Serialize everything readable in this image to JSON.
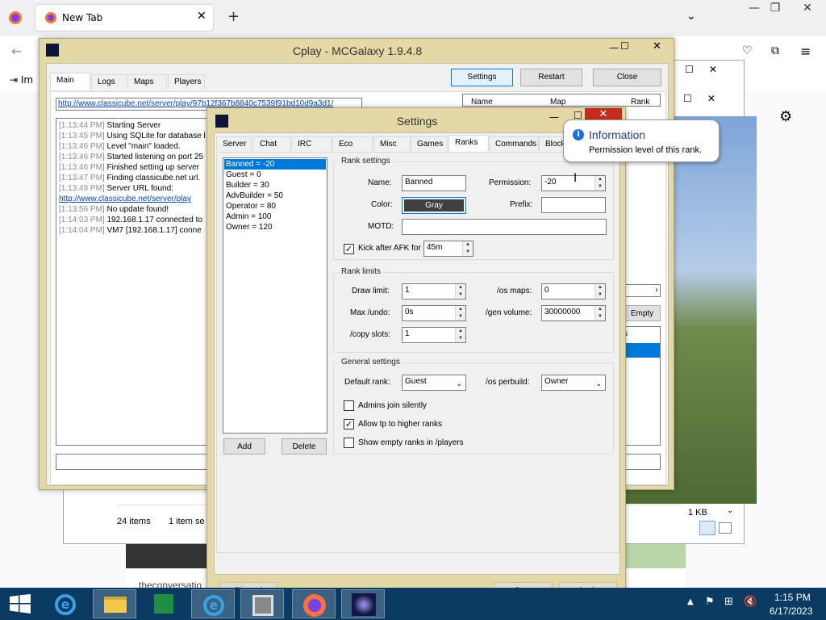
{
  "browser": {
    "tab_title": "New Tab",
    "new_tab_symbol": "+",
    "bookmark_import": "Im",
    "icons": [
      "firefox-icon",
      "close-icon",
      "back-icon",
      "pocket-icon",
      "extensions-icon",
      "menu-icon",
      "settings-icon"
    ]
  },
  "explorer": {
    "items_count": "24 items",
    "selected_count": "1 item se",
    "size": "1 KB",
    "empty_button": "Empty",
    "cs_text": "cs",
    "article_text": "theconversatio"
  },
  "mcgalaxy": {
    "title": "Cplay - MCGalaxy 1.9.4.8",
    "tabs": [
      "Main",
      "Logs",
      "Maps",
      "Players"
    ],
    "buttons": {
      "settings": "Settings",
      "restart": "Restart",
      "close": "Close"
    },
    "url": "http://www.classicube.net/server/play/97b12f367b8840c7539f91bd10d9a3d1/",
    "table_headers": [
      "Name",
      "Map",
      "Rank"
    ],
    "log": [
      {
        "time": "[1:13:44 PM]",
        "text": "Starting Server"
      },
      {
        "time": "[1:13:45 PM]",
        "text": "Using SQLite for database l"
      },
      {
        "time": "[1:13:46 PM]",
        "text": "Level \"main\" loaded."
      },
      {
        "time": "[1:13:46 PM]",
        "text": "Started listening on port 25"
      },
      {
        "time": "[1:13:46 PM]",
        "text": "Finished setting up server"
      },
      {
        "time": "[1:13:47 PM]",
        "text": "Finding classicube.net url."
      },
      {
        "time": "[1:13:49 PM]",
        "text": "Server URL found:"
      },
      {
        "time": "",
        "text": "http://www.classicube.net/server/play"
      },
      {
        "time": "[1:13:56 PM]",
        "text": "No update found!"
      },
      {
        "time": "[1:14:03 PM]",
        "text": "192.168.1.17 connected to"
      },
      {
        "time": "[1:14:04 PM]",
        "text": "VM7 [192.168.1.17] conne"
      }
    ]
  },
  "settings": {
    "title": "Settings",
    "tabs": [
      "Server",
      "Chat",
      "IRC",
      "Eco",
      "Misc",
      "Games",
      "Ranks",
      "Commands",
      "Block"
    ],
    "ranks": [
      "Banned = -20",
      "Guest = 0",
      "Builder = 30",
      "AdvBuilder = 50",
      "Operator = 80",
      "Admin = 100",
      "Owner = 120"
    ],
    "add_button": "Add",
    "delete_button": "Delete",
    "rank_settings": {
      "group": "Rank settings",
      "name_label": "Name:",
      "name_value": "Banned",
      "permission_label": "Permission:",
      "permission_value": "-20",
      "color_label": "Color:",
      "color_value": "Gray",
      "prefix_label": "Prefix:",
      "prefix_value": "",
      "motd_label": "MOTD:",
      "motd_value": "",
      "kick_label": "Kick after AFK for",
      "kick_value": "45m",
      "kick_checked": true
    },
    "rank_limits": {
      "group": "Rank limits",
      "draw_label": "Draw limit:",
      "draw_value": "1",
      "osmaps_label": "/os maps:",
      "osmaps_value": "0",
      "maxundo_label": "Max /undo:",
      "maxundo_value": "0s",
      "genvol_label": "/gen volume:",
      "genvol_value": "30000000",
      "copy_label": "/copy slots:",
      "copy_value": "1"
    },
    "general": {
      "group": "General settings",
      "default_label": "Default rank:",
      "default_value": "Guest",
      "perbuild_label": "/os perbuild:",
      "perbuild_value": "Owner",
      "admins_join": "Admins join silently",
      "admins_join_checked": false,
      "allow_tp": "Allow tp to higher ranks",
      "allow_tp_checked": true,
      "show_empty": "Show empty ranks in /players",
      "show_empty_checked": false
    },
    "footer": {
      "discard": "Discard",
      "save": "Save",
      "apply": "Apply"
    }
  },
  "tooltip": {
    "title": "Information",
    "text": "Permission level of this rank."
  },
  "taskbar": {
    "time": "1:15 PM",
    "date": "6/17/2023",
    "apps": [
      "start-icon",
      "internet-explorer-icon",
      "file-explorer-icon",
      "store-icon",
      "internet-explorer-icon",
      "package-icon",
      "firefox-icon",
      "mcgalaxy-icon"
    ]
  },
  "colors": {
    "accent": "#0078d7",
    "frame": "#e3d8a6",
    "taskbar": "#0b3b63",
    "close_red": "#e81123"
  }
}
